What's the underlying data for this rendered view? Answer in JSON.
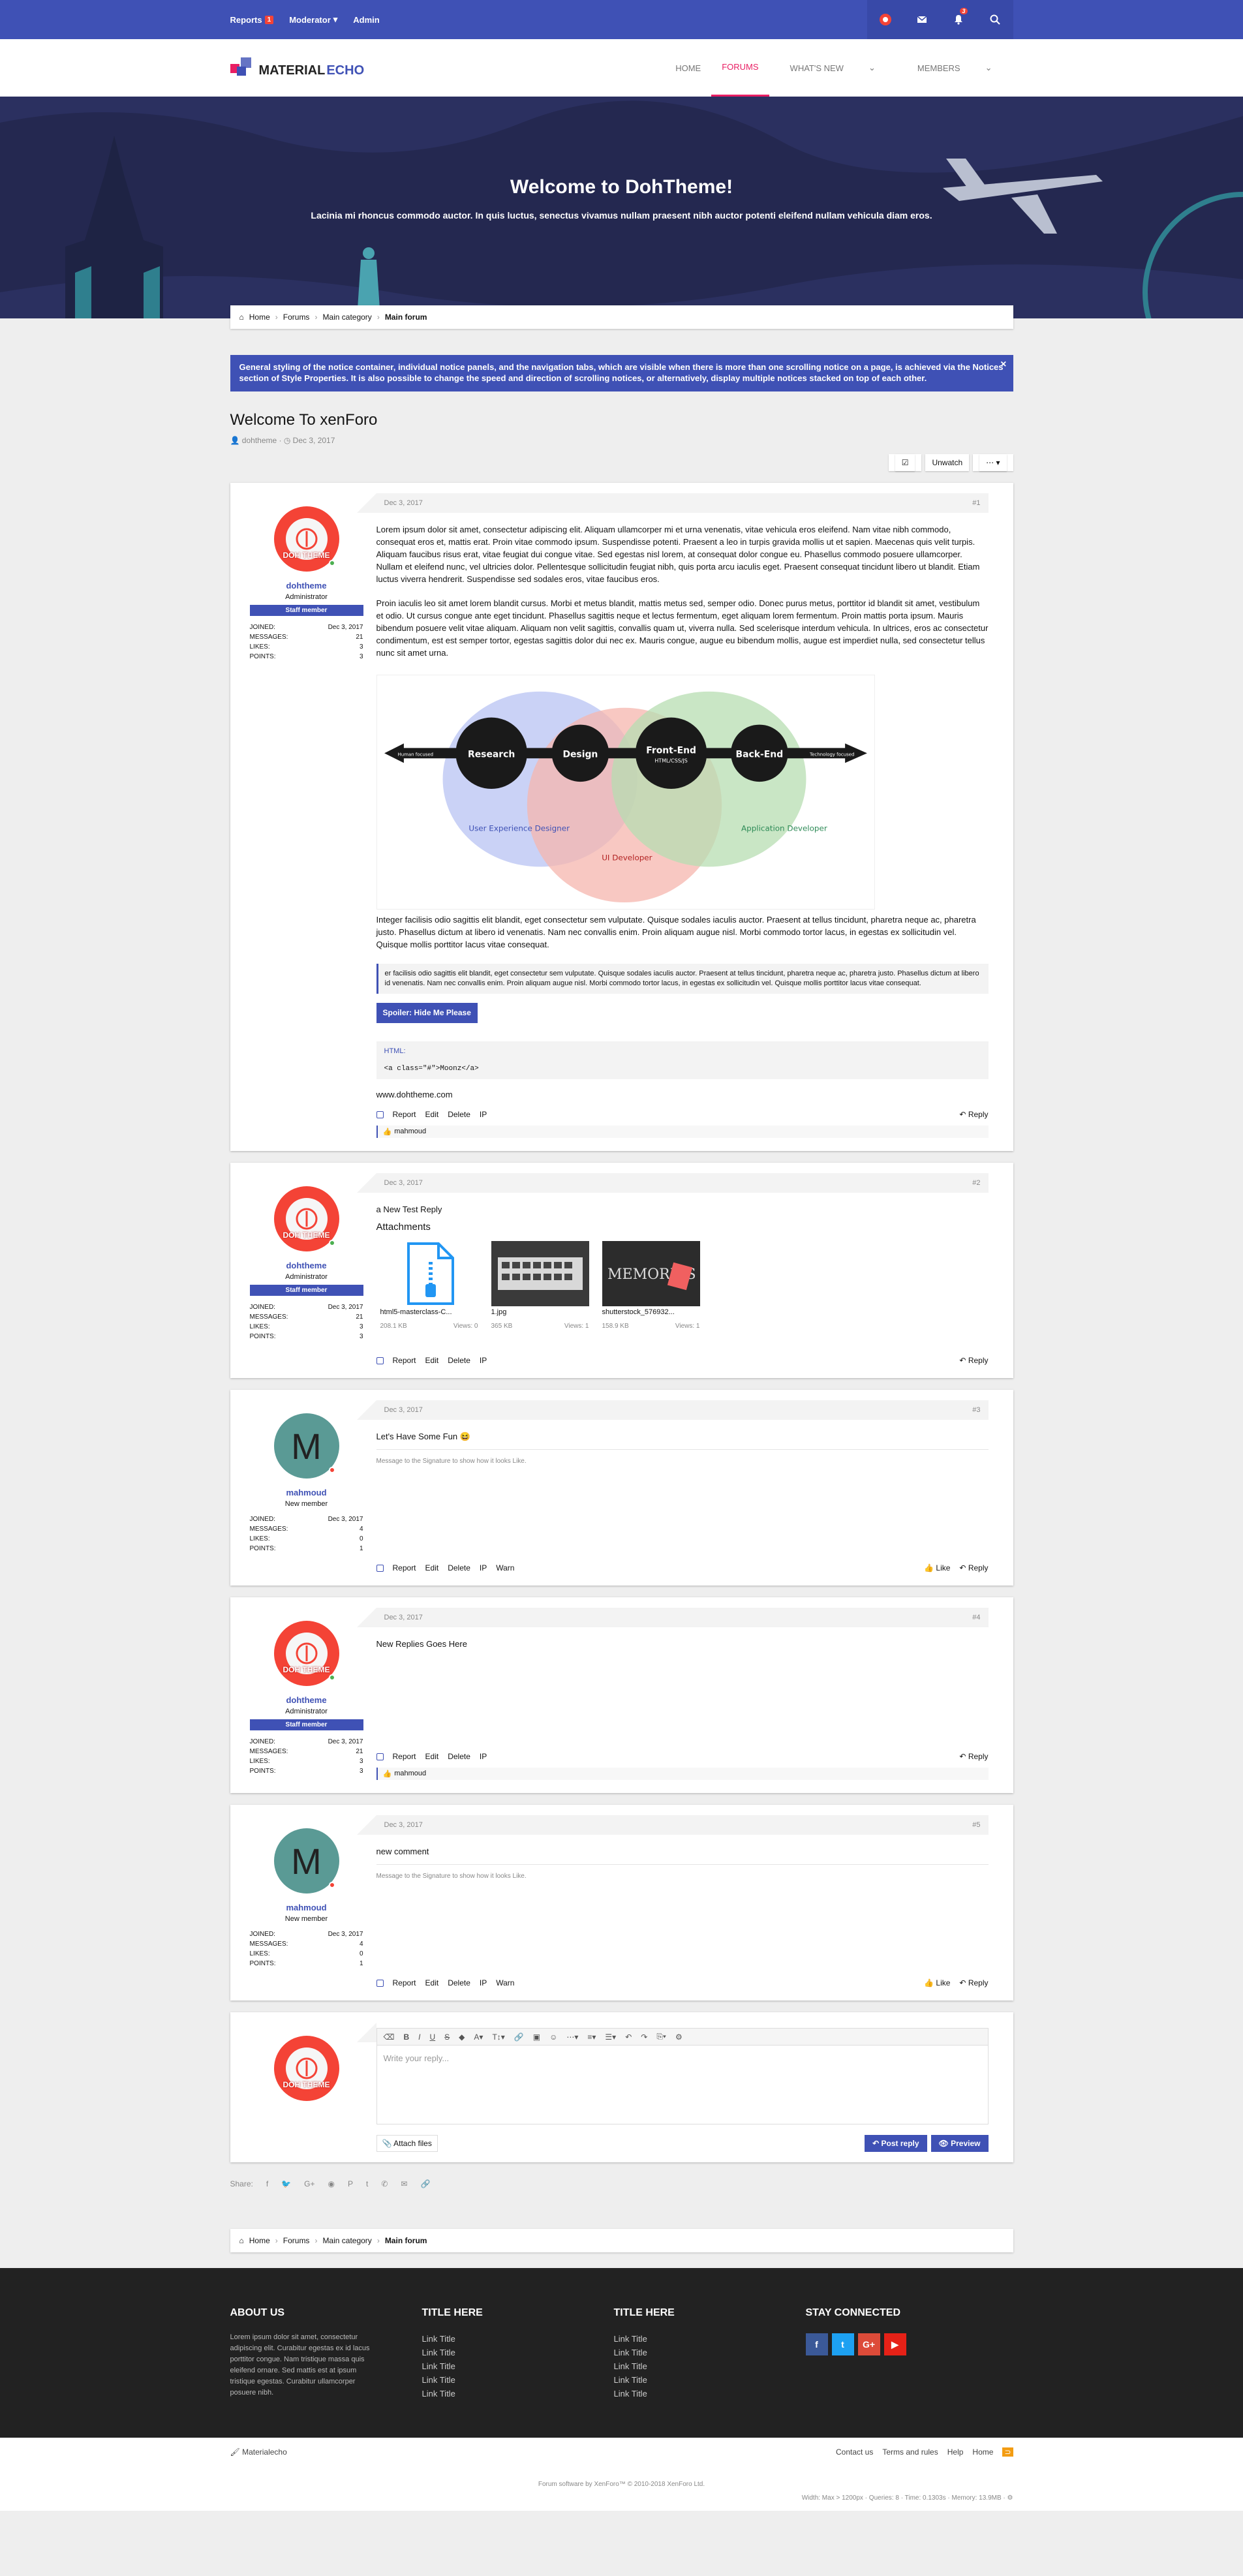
{
  "topbar": {
    "reports": "Reports",
    "reports_badge": "1",
    "moderator": "Moderator",
    "admin": "Admin",
    "alert_badge": "3"
  },
  "brand": {
    "logo_text_1": "MATERIAL",
    "logo_text_2": "ECHO"
  },
  "nav": {
    "home": "HOME",
    "forums": "FORUMS",
    "whats_new": "WHAT'S NEW",
    "members": "MEMBERS"
  },
  "hero": {
    "title": "Welcome to DohTheme!",
    "subtitle": "Lacinia mi rhoncus commodo auctor. In quis luctus, senectus vivamus nullam praesent nibh auctor potenti eleifend nullam vehicula diam eros."
  },
  "breadcrumb": [
    "Home",
    "Forums",
    "Main category",
    "Main forum"
  ],
  "notice": "General styling of the notice container, individual notice panels, and the navigation tabs, which are visible when there is more than one scrolling notice on a page, is achieved via the Notices section of Style Properties. It is also possible to change the speed and direction of scrolling notices, or alternatively, display multiple notices stacked on top of each other.",
  "thread": {
    "title": "Welcome To xenForo",
    "author": "dohtheme",
    "date": "Dec 3, 2017",
    "unwatch": "Unwatch"
  },
  "labels": {
    "joined": "JOINED:",
    "messages": "MESSAGES:",
    "likes": "LIKES:",
    "points": "POINTS:",
    "staff": "Staff member",
    "report": "Report",
    "edit": "Edit",
    "delete": "Delete",
    "ip": "IP",
    "warn": "Warn",
    "reply": "Reply",
    "like": "Like",
    "attachments": "Attachments",
    "avatar_label": "DOH THEME",
    "letter": "M",
    "x": "×"
  },
  "posts": [
    {
      "user": "dohtheme",
      "role": "Administrator",
      "joined": "Dec 3, 2017",
      "messages": "21",
      "likes": "3",
      "points": "3",
      "date": "Dec 3, 2017",
      "num": "#1"
    },
    {
      "user": "dohtheme",
      "role": "Administrator",
      "joined": "Dec 3, 2017",
      "messages": "21",
      "likes": "3",
      "points": "3",
      "date": "Dec 3, 2017",
      "num": "#2",
      "text": "a New Test Reply"
    },
    {
      "user": "mahmoud",
      "role": "New member",
      "joined": "Dec 3, 2017",
      "messages": "4",
      "likes": "0",
      "points": "1",
      "date": "Dec 3, 2017",
      "num": "#3",
      "text": "Let's Have Some Fun 😆",
      "sig": "Message to the Signature to show how it looks Like."
    },
    {
      "user": "dohtheme",
      "role": "Administrator",
      "joined": "Dec 3, 2017",
      "messages": "21",
      "likes": "3",
      "points": "3",
      "date": "Dec 3, 2017",
      "num": "#4",
      "text": "New Replies Goes Here"
    },
    {
      "user": "mahmoud",
      "role": "New member",
      "joined": "Dec 3, 2017",
      "messages": "4",
      "likes": "0",
      "points": "1",
      "date": "Dec 3, 2017",
      "num": "#5",
      "text": "new comment",
      "sig": "Message to the Signature to show how it looks Like."
    }
  ],
  "post1": {
    "p1": "Lorem ipsum dolor sit amet, consectetur adipiscing elit. Aliquam ullamcorper mi et urna venenatis, vitae vehicula eros eleifend. Nam vitae nibh commodo, consequat eros et, mattis erat. Proin vitae commodo ipsum. Suspendisse potenti. Praesent a leo in turpis gravida mollis ut et sapien. Maecenas quis velit turpis. Aliquam faucibus risus erat, vitae feugiat dui congue vitae. Sed egestas nisl lorem, at consequat dolor congue eu. Phasellus commodo posuere ullamcorper. Nullam et eleifend nunc, vel ultricies dolor. Pellentesque sollicitudin feugiat nibh, quis porta arcu iaculis eget. Praesent consequat tincidunt libero ut blandit. Etiam luctus viverra hendrerit. Suspendisse sed sodales eros, vitae faucibus eros.",
    "p2": "Proin iaculis leo sit amet lorem blandit cursus. Morbi et metus blandit, mattis metus sed, semper odio. Donec purus metus, porttitor id blandit sit amet, vestibulum et odio. Ut cursus congue ante eget tincidunt. Phasellus sagittis neque et lectus fermentum, eget aliquam lorem fermentum. Proin mattis porta ipsum. Mauris bibendum posuere velit vitae aliquam. Aliquam non velit sagittis, convallis quam ut, viverra nulla. Sed scelerisque interdum vehicula. In ultrices, eros ac consectetur condimentum, est est semper tortor, egestas sagittis dolor dui nec ex. Mauris congue, augue eu bibendum mollis, augue est imperdiet nulla, sed consectetur tellus nunc sit amet urna.",
    "p3": "Integer facilisis odio sagittis elit blandit, eget consectetur sem vulputate. Quisque sodales iaculis auctor. Praesent at tellus tincidunt, pharetra neque ac, pharetra justo. Phasellus dictum at libero id venenatis. Nam nec convallis enim. Proin aliquam augue nisl. Morbi commodo tortor lacus, in egestas ex sollicitudin vel. Quisque mollis porttitor lacus vitae consequat.",
    "quote": "er facilisis odio sagittis elit blandit, eget consectetur sem vulputate. Quisque sodales iaculis auctor. Praesent at tellus tincidunt, pharetra neque ac, pharetra justo. Phasellus dictum at libero id venenatis. Nam nec convallis enim. Proin aliquam augue nisl. Morbi commodo tortor lacus, in egestas ex sollicitudin vel. Quisque mollis porttitor lacus vitae consequat.",
    "spoiler": "Spoiler: Hide Me Please",
    "code_label": "HTML:",
    "code": "<a class=\"#\">Moonz</a>",
    "link": "www.dohtheme.com",
    "liker": "mahmoud"
  },
  "diagram": {
    "research": "Research",
    "design": "Design",
    "frontend": "Front-End",
    "frontend_sub": "HTML/CSS/JS",
    "backend": "Back-End",
    "left": "Human focused",
    "right": "Technology focused",
    "ux": "User Experience Designer",
    "ui": "UI Developer",
    "app": "Application Developer"
  },
  "attachments": [
    {
      "name": "html5-masterclass-C...",
      "size": "208.1 KB",
      "views": "Views: 0"
    },
    {
      "name": "1.jpg",
      "size": "365 KB",
      "views": "Views: 1"
    },
    {
      "name": "shutterstock_576932...",
      "size": "158.9 KB",
      "views": "Views: 1"
    }
  ],
  "editor": {
    "placeholder": "Write your reply...",
    "attach": "Attach files",
    "post": "Post reply",
    "preview": "Preview"
  },
  "share_label": "Share:",
  "footer": {
    "about_title": "ABOUT US",
    "about_text": "Lorem ipsum dolor sit amet, consectetur adipiscing elit. Curabitur egestas ex id lacus porttitor congue. Nam tristique massa quis eleifend ornare. Sed mattis est at ipsum tristique egestas. Curabitur ullamcorper posuere nibh.",
    "col2_title": "TITLE HERE",
    "col3_title": "TITLE HERE",
    "links": [
      "Link Title",
      "Link Title",
      "Link Title",
      "Link Title",
      "Link Title"
    ],
    "stay": "STAY CONNECTED",
    "social": {
      "facebook": "f",
      "twitter": "t",
      "google": "G+",
      "youtube": "▶"
    },
    "style_name": "Materialecho",
    "bottom_links": [
      "Contact us",
      "Terms and rules",
      "Help",
      "Home"
    ],
    "copyright": "Forum software by XenForo™ © 2010-2018 XenForo Ltd.",
    "debug": "Width: Max > 1200px · Queries: 8 · Time: 0.1303s · Memory: 13.9MB · ⚙"
  },
  "colors": {
    "primary": "#3f51b5",
    "accent": "#e91e63",
    "danger": "#f44336",
    "hero": "#242850",
    "footer": "#222222"
  }
}
